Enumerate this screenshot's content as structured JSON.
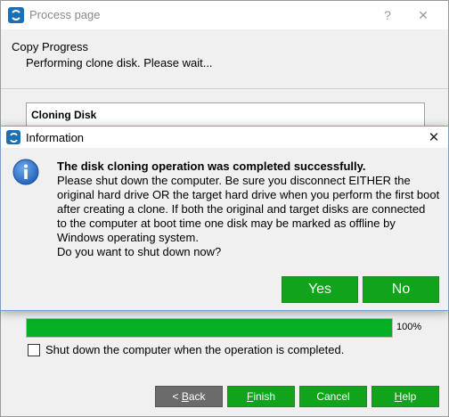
{
  "window": {
    "title": "Process page",
    "help_label": "?",
    "close_label": "✕"
  },
  "header": {
    "title": "Copy Progress",
    "subtitle": "Performing clone disk. Please wait..."
  },
  "cloning": {
    "label": "Cloning Disk"
  },
  "progress": {
    "value": 1.0,
    "text": "100%",
    "color": "#06b025"
  },
  "checkbox": {
    "label": "Shut down the computer when the operation is completed.",
    "checked": false
  },
  "buttons": {
    "back_accel": "B",
    "back_rest": "ack",
    "back_prefix": "< ",
    "finish_accel": "F",
    "finish_rest": "inish",
    "cancel_label": "Cancel",
    "help_accel": "H",
    "help_rest": "elp"
  },
  "dialog": {
    "title": "Information",
    "close_label": "✕",
    "heading": "The disk cloning operation was completed successfully.",
    "body": "Please shut down the computer. Be sure you disconnect EITHER the\noriginal hard drive OR the target hard drive when you perform the first boot\nafter creating a clone. If both the original and target disks are connected\nto the computer at boot time one disk may be marked as offline by\nWindows operating system.\nDo you want to shut down now?",
    "yes_label": "Yes",
    "no_label": "No"
  },
  "colors": {
    "accent_green": "#11a31c",
    "back_gray": "#6b6b6b",
    "info_blue": "#1d5fb8"
  },
  "icons": {
    "app": "app-logo-icon",
    "info": "info-icon"
  }
}
